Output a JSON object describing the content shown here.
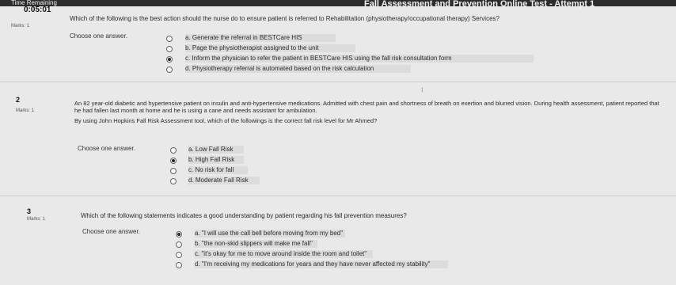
{
  "header": {
    "time_label": "Time Remaining",
    "time_value": "0:05:01",
    "title": "Fall Assessment and Prevention Online Test - Attempt 1"
  },
  "questions": [
    {
      "number": "",
      "marks": "Marks: 1",
      "text": "Which of the following is the best action should the nurse do to ensure patient is referred to Rehabilitation (physiotherapy/occupational therapy) Services?",
      "choose_label": "Choose one answer.",
      "options": [
        {
          "label": "a. Generate the referral in BESTCare HIS",
          "checked": false
        },
        {
          "label": "b. Page the physiotherapist assigned to the unit",
          "checked": false
        },
        {
          "label": "c. Inform the physician to refer the patient in BESTCare HIS using the fall risk consultation form",
          "checked": true
        },
        {
          "label": "d. Physiotherapy referral is automated based on the risk calculation",
          "checked": false
        }
      ]
    },
    {
      "number": "2",
      "marks": "Marks: 1",
      "text_line1": "An 82 year-old diabetic and hypertensive patient on insulin and anti-hypertensive medications. Admitted with chest pain and shortness of breath on exertion and blurred vision. During health assessment, patient reported that",
      "text_line2": "he had fallen last month at home and he is using a cane and needs assistant for ambulation.",
      "text_line3": "By using John Hopkins Fall Risk Assessment tool, which of the followings is the correct fall risk level for Mr Ahmed?",
      "choose_label": "Choose one answer.",
      "options": [
        {
          "label": "a. Low Fall Risk",
          "checked": false
        },
        {
          "label": "b. High Fall Risk",
          "checked": true
        },
        {
          "label": "c. No risk for fall",
          "checked": false
        },
        {
          "label": "d. Moderate Fall Risk",
          "checked": false
        }
      ]
    },
    {
      "number": "3",
      "marks": "Marks: 1",
      "text": "Which of the following statements indicates a good understanding by patient regarding his fall prevention measures?",
      "choose_label": "Choose one answer.",
      "options": [
        {
          "label": "a. \"I will use the call bell before moving from my bed\"",
          "checked": true
        },
        {
          "label": "b. \"the non-skid slippers will make me fall\"",
          "checked": false
        },
        {
          "label": "c. \"it's okay for me to move around inside the room and toilet\"",
          "checked": false
        },
        {
          "label": "d. \"I'm receiving my medications for years and they have never affected my stability\"",
          "checked": false
        }
      ]
    }
  ]
}
